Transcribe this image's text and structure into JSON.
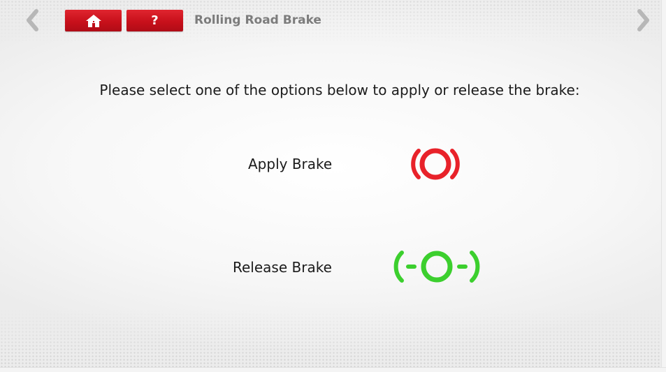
{
  "header": {
    "title": "Rolling Road Brake",
    "help_label": "?",
    "home_icon": "home-icon",
    "back_icon": "chevron-left-icon",
    "forward_icon": "chevron-right-icon",
    "button_color": "#cc1420"
  },
  "main": {
    "instruction": "Please select one of the options below to apply or release the brake:",
    "options": [
      {
        "label": "Apply Brake",
        "icon": "brake-applied-icon",
        "color": "#e8222a"
      },
      {
        "label": "Release Brake",
        "icon": "brake-released-icon",
        "color": "#3ccf2e"
      }
    ]
  }
}
